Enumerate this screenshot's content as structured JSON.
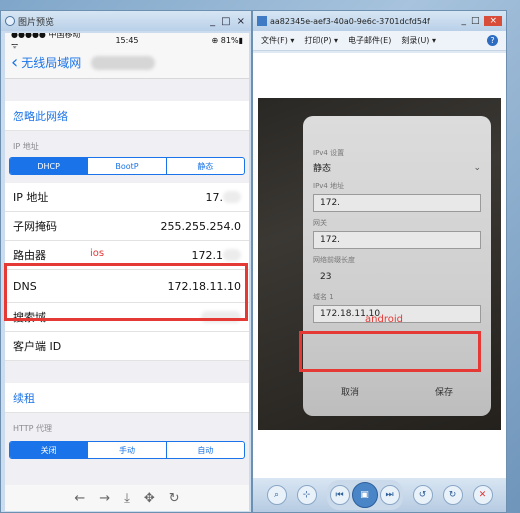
{
  "left_window": {
    "title": "图片预览",
    "buttons": [
      "_",
      "□",
      "×"
    ],
    "statusbar": {
      "carrier": "●●●●● 中国移动 ᯤ",
      "time": "15:45",
      "battery": "⊕ 81%▮"
    },
    "nav": {
      "back_title": "无线局域网"
    },
    "forget_network": "忽略此网络",
    "ip_section_label": "IP 地址",
    "ip_modes": [
      "DHCP",
      "BootP",
      "静态"
    ],
    "ip_rows": [
      {
        "label": "IP 地址",
        "value": "17."
      },
      {
        "label": "子网掩码",
        "value": "255.255.254.0"
      },
      {
        "label": "路由器",
        "value": "172.1"
      },
      {
        "label": "DNS",
        "value": "172.18.11.10"
      },
      {
        "label": "搜索域",
        "value": ""
      },
      {
        "label": "客户端 ID",
        "value": ""
      }
    ],
    "renew_lease": "续租",
    "http_proxy_label": "HTTP 代理",
    "proxy_modes": [
      "关闭",
      "手动",
      "自动"
    ],
    "ios_annotation": "ios"
  },
  "right_window": {
    "title": "aa82345e-aef3-40a0-9e6c-3701dcfd54f",
    "buttons": [
      "_",
      "□",
      "×"
    ],
    "menu": [
      "文件(F) ▾",
      "打印(P) ▾",
      "电子邮件(E)",
      "刻录(U) ▾"
    ],
    "android_screen": {
      "ipv4_settings_label": "IPv4 设置",
      "ipv4_mode": "静态",
      "ipv4_address_label": "IPv4 地址",
      "ipv4_address": "172.",
      "gateway_label": "网关",
      "gateway": "172.",
      "prefix_label": "网络前缀长度",
      "prefix": "23",
      "dns1_label": "域名 1",
      "dns1": "172.18.11.10",
      "cancel": "取消",
      "save": "保存"
    },
    "android_annotation": "android"
  },
  "colors": {
    "accent": "#1a73e8",
    "annotation": "#e53935"
  }
}
